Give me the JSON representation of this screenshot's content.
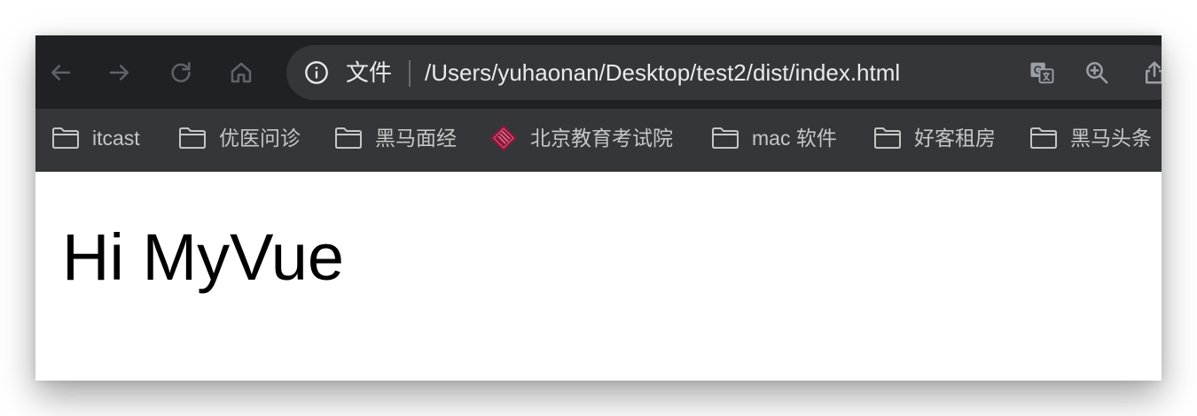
{
  "toolbar": {
    "back_icon": "arrow-left-icon",
    "forward_icon": "arrow-right-icon",
    "reload_icon": "reload-icon",
    "home_icon": "home-icon"
  },
  "omnibox": {
    "info_icon": "info-icon",
    "security_label": "文件",
    "url": "/Users/yuhaonan/Desktop/test2/dist/index.html",
    "translate_icon": "translate-icon",
    "zoom_icon": "zoom-in-icon",
    "share_icon": "share-icon"
  },
  "bookmarks": {
    "items": [
      {
        "label": "itcast",
        "icon": "folder-icon"
      },
      {
        "label": "优医问诊",
        "icon": "folder-icon"
      },
      {
        "label": "黑马面经",
        "icon": "folder-icon"
      },
      {
        "label": "北京教育考试院",
        "icon": "site-favicon-icon"
      },
      {
        "label": "mac 软件",
        "icon": "folder-icon"
      },
      {
        "label": "好客租房",
        "icon": "folder-icon"
      },
      {
        "label": "黑马头条",
        "icon": "folder-icon"
      }
    ]
  },
  "page": {
    "heading": "Hi MyVue"
  },
  "colors": {
    "toolbar_bg": "#202124",
    "omnibox_bg": "#35363a",
    "bookmarks_bg": "#35363a",
    "icon_color": "#9aa0a6",
    "text_color": "#e8eaed",
    "favicon_color": "#8b1538"
  }
}
